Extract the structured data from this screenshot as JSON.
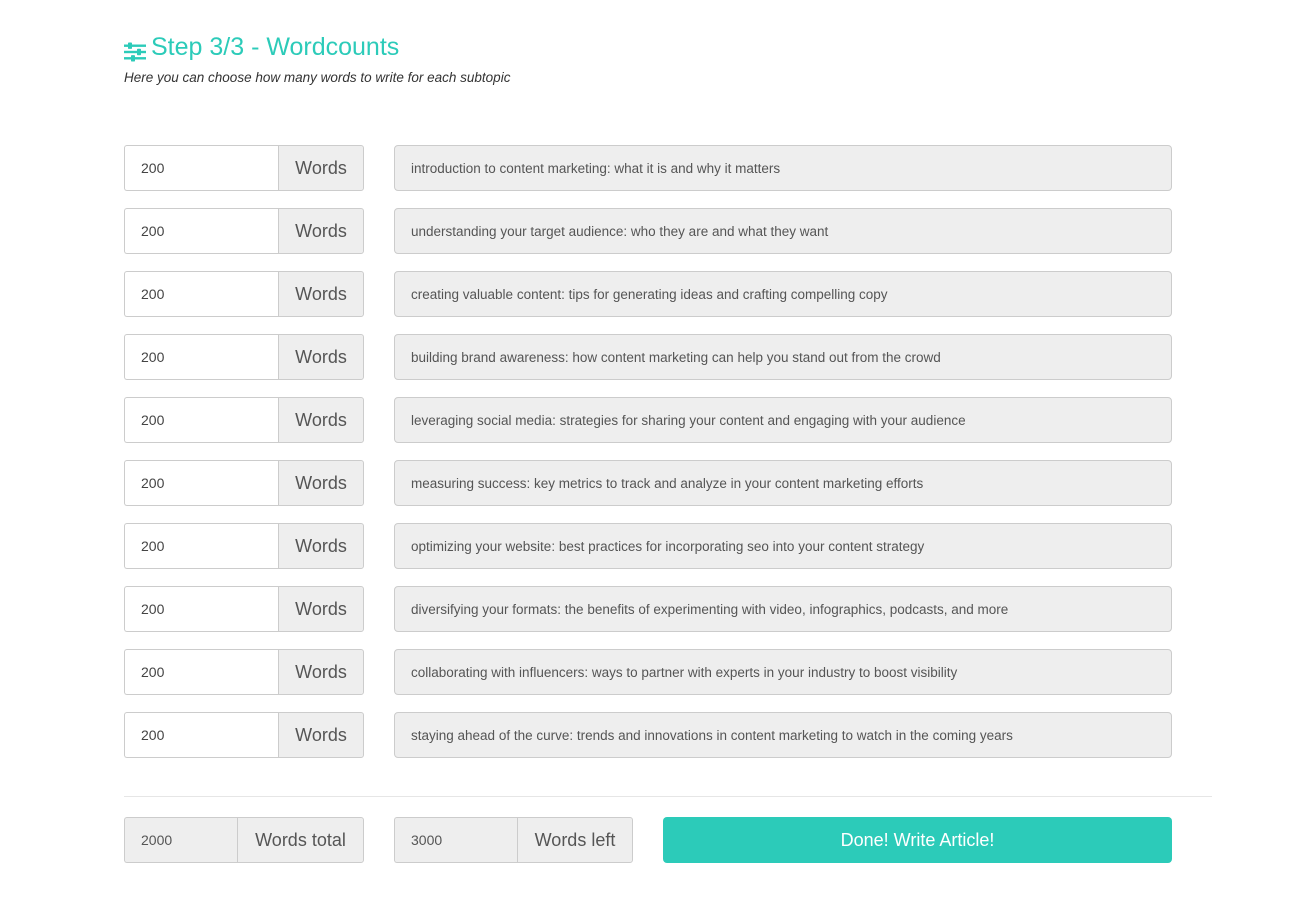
{
  "header": {
    "title": "Step 3/3 - Wordcounts",
    "subtitle": "Here you can choose how many words to write for each subtopic",
    "icon": "sliders-icon",
    "accent_color": "#2ccbb9"
  },
  "unit_label": "Words",
  "subtopics": [
    {
      "words": "200",
      "topic": "introduction to content marketing: what it is and why it matters"
    },
    {
      "words": "200",
      "topic": "understanding your target audience: who they are and what they want"
    },
    {
      "words": "200",
      "topic": "creating valuable content: tips for generating ideas and crafting compelling copy"
    },
    {
      "words": "200",
      "topic": "building brand awareness: how content marketing can help you stand out from the crowd"
    },
    {
      "words": "200",
      "topic": "leveraging social media: strategies for sharing your content and engaging with your audience"
    },
    {
      "words": "200",
      "topic": "measuring success: key metrics to track and analyze in your content marketing efforts"
    },
    {
      "words": "200",
      "topic": "optimizing your website: best practices for incorporating seo into your content strategy"
    },
    {
      "words": "200",
      "topic": "diversifying your formats: the benefits of experimenting with video, infographics, podcasts, and more"
    },
    {
      "words": "200",
      "topic": "collaborating with influencers: ways to partner with experts in your industry to boost visibility"
    },
    {
      "words": "200",
      "topic": "staying ahead of the curve: trends and innovations in content marketing to watch in the coming years"
    }
  ],
  "footer": {
    "total_value": "2000",
    "total_label": "Words total",
    "left_value": "3000",
    "left_label": "Words left",
    "done_label": "Done! Write Article!"
  }
}
